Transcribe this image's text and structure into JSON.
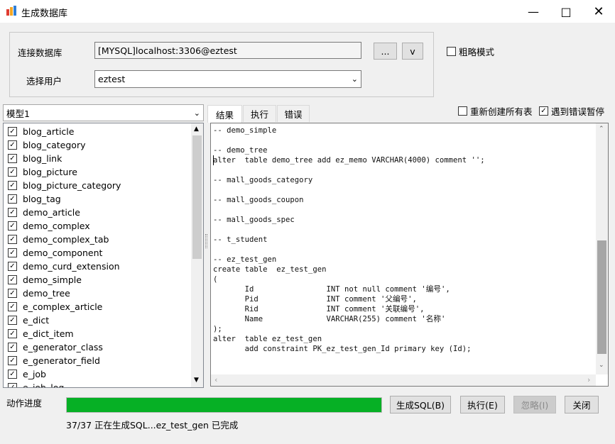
{
  "window": {
    "title": "生成数据库"
  },
  "connection": {
    "db_label": "连接数据库",
    "db_value": "[MYSQL]localhost:3306@eztest",
    "browse_label": "...",
    "dropdown_label": "v",
    "user_label": "选择用户",
    "user_value": "eztest"
  },
  "options": {
    "rough_mode": {
      "label": "粗略模式",
      "checked": false
    },
    "recreate_all": {
      "label": "重新创建所有表",
      "checked": false
    },
    "pause_on_error": {
      "label": "遇到错误暂停",
      "checked": true
    }
  },
  "model": {
    "selected": "模型1"
  },
  "tables": [
    "blog_article",
    "blog_category",
    "blog_link",
    "blog_picture",
    "blog_picture_category",
    "blog_tag",
    "demo_article",
    "demo_complex",
    "demo_complex_tab",
    "demo_component",
    "demo_curd_extension",
    "demo_simple",
    "demo_tree",
    "e_complex_article",
    "e_dict",
    "e_dict_item",
    "e_generator_class",
    "e_generator_field",
    "e_job",
    "e_job_log"
  ],
  "tabs": [
    "结果",
    "执行",
    "错误"
  ],
  "sql_output": "-- demo_simple\n\n-- demo_tree\nalter  table demo_tree add ez_memo VARCHAR(4000) comment '';\n\n-- mall_goods_category\n\n-- mall_goods_coupon\n\n-- mall_goods_spec\n\n-- t_student\n\n-- ez_test_gen\ncreate table  ez_test_gen\n(\n       Id                INT not null comment '编号',\n       Pid               INT comment '父编号',\n       Rid               INT comment '关联编号',\n       Name              VARCHAR(255) comment '名称'\n);\nalter  table ez_test_gen\n       add constraint PK_ez_test_gen_Id primary key (Id);",
  "progress": {
    "label": "动作进度",
    "fraction": 1.0,
    "status": "37/37 正在生成SQL...ez_test_gen 已完成",
    "color": "#06b025"
  },
  "buttons": {
    "generate": "生成SQL(B)",
    "execute": "执行(E)",
    "ignore": "忽略(I)",
    "close": "关闭"
  }
}
